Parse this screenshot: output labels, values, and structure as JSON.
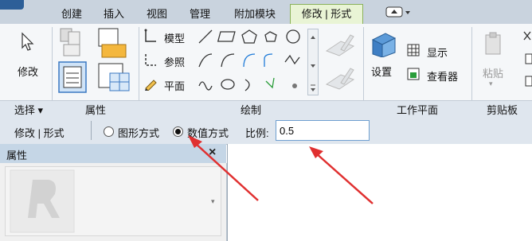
{
  "tabs": [
    "创建",
    "插入",
    "视图",
    "管理",
    "附加模块",
    "修改 | 形式"
  ],
  "ribbon": {
    "select_tool": "修改",
    "draw": {
      "model": "模型",
      "reference": "参照",
      "plane": "平面"
    },
    "workplane": {
      "set": "设置",
      "show": "显示",
      "viewer": "查看器"
    },
    "clipboard": {
      "paste": "粘贴"
    }
  },
  "panels": {
    "select": "选择 ▾",
    "properties": "属性",
    "draw": "绘制",
    "workplane": "工作平面",
    "clipboard": "剪贴板"
  },
  "options_bar": {
    "context": "修改 | 形式",
    "graphic_mode": "图形方式",
    "numeric_mode": "数值方式",
    "scale_label": "比例:",
    "scale_value": "0.5",
    "selected_mode": "numeric"
  },
  "properties_palette": {
    "title": "属性",
    "close": "×"
  },
  "colors": {
    "accent_tab": "#e9f4d5",
    "annotation_arrow": "#e03030",
    "input_border": "#6f9fd0"
  }
}
